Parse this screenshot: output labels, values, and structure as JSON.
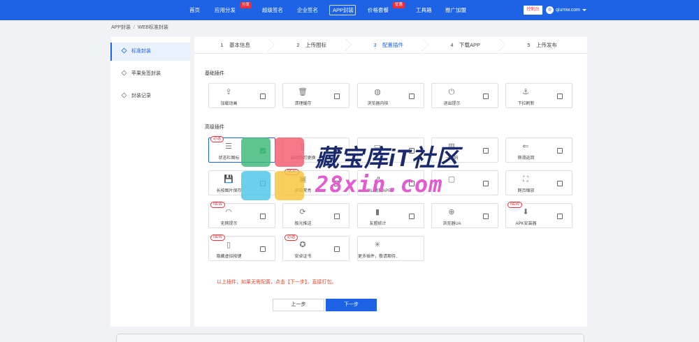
{
  "nav": {
    "items": [
      {
        "label": "首页"
      },
      {
        "label": "应用分发",
        "badge": "分发"
      },
      {
        "label": "超级签名"
      },
      {
        "label": "企业签名"
      },
      {
        "label": "APP封装"
      },
      {
        "label": "价格套餐",
        "badge": "优惠"
      },
      {
        "label": "工具箱"
      },
      {
        "label": "推广加盟"
      }
    ],
    "console": "控制台",
    "user": "qiumw.com"
  },
  "breadcrumb": {
    "root": "APP封装",
    "sep": "/",
    "current": "WEB标准封装"
  },
  "sidebar": {
    "items": [
      {
        "label": "标准封装"
      },
      {
        "label": "苹果免签封装"
      },
      {
        "label": "封装记录"
      }
    ]
  },
  "steps": [
    {
      "num": "1",
      "label": "基本信息"
    },
    {
      "num": "2",
      "label": "上传图标"
    },
    {
      "num": "3",
      "label": "配置插件"
    },
    {
      "num": "4",
      "label": "下载APP"
    },
    {
      "num": "5",
      "label": "上传发布"
    }
  ],
  "basic": {
    "title": "基础插件",
    "items": [
      {
        "label": "加载动画",
        "icon": "upload-icon",
        "glyph": "⇪"
      },
      {
        "label": "清理缓存",
        "icon": "trash-icon",
        "glyph": "🗑"
      },
      {
        "label": "浏览器内核",
        "icon": "planet-icon",
        "glyph": "◍"
      },
      {
        "label": "退出提示",
        "icon": "power-icon",
        "glyph": "⏻"
      },
      {
        "label": "下拉刷新",
        "icon": "anchor-icon",
        "glyph": "⚓"
      }
    ]
  },
  "advanced": {
    "title": "高级插件",
    "items": [
      {
        "label": "状态栏图标",
        "icon": "statusbar-icon",
        "glyph": "☰",
        "tag": "必选",
        "checked": true
      },
      {
        "label": "启动页可更换",
        "icon": "phone-icon",
        "glyph": "▯"
      },
      {
        "label": "",
        "icon": "pages-icon",
        "glyph": "▭"
      },
      {
        "label": "一维码",
        "icon": "barcode-icon",
        "glyph": "▥"
      },
      {
        "label": "侧滑返回",
        "icon": "swipe-back-icon",
        "glyph": "⇐"
      },
      {
        "label": "长按图片保存",
        "icon": "save-icon",
        "glyph": "💾"
      },
      {
        "label": "屏幕常亮",
        "icon": "screen-icon",
        "glyph": "▣",
        "tag": "NEW"
      },
      {
        "label": "URL 跳转APP",
        "icon": "link-icon",
        "glyph": "⇗"
      },
      {
        "label": "",
        "icon": "window-icon",
        "glyph": "▢"
      },
      {
        "label": "网页缩放",
        "icon": "zoom-icon",
        "glyph": "⛶"
      },
      {
        "label": "无网提示",
        "icon": "wifi-icon",
        "glyph": "◠",
        "tag": "NEW"
      },
      {
        "label": "极光推送",
        "icon": "push-icon",
        "glyph": "⟳"
      },
      {
        "label": "友盟统计",
        "icon": "chart-icon",
        "glyph": "▮"
      },
      {
        "label": "浏览器UA",
        "icon": "globe-icon",
        "glyph": "⊕"
      },
      {
        "label": "APK安装器",
        "icon": "installer-icon",
        "glyph": "⬇",
        "tag": "NEW"
      },
      {
        "label": "隐藏虚拟按键",
        "icon": "phone-key-icon",
        "glyph": "▯",
        "tag": "NEW"
      },
      {
        "label": "安卓证书",
        "icon": "cert-icon",
        "glyph": "✪",
        "tag": "必选"
      },
      {
        "label": "更多插件，敬请期待…",
        "icon": "loading-icon",
        "glyph": "✳"
      }
    ]
  },
  "hint": "以上插件，如果无需配置，点击【下一步】，直接打包。",
  "buttons": {
    "prev": "上一步",
    "next": "下一步"
  },
  "watermark": {
    "line1": "藏宝库iT社区",
    "line2": "28xin.com"
  },
  "colors": {
    "primary": "#1e63e6",
    "danger": "#e8313a",
    "checked": "#3aa76d"
  }
}
